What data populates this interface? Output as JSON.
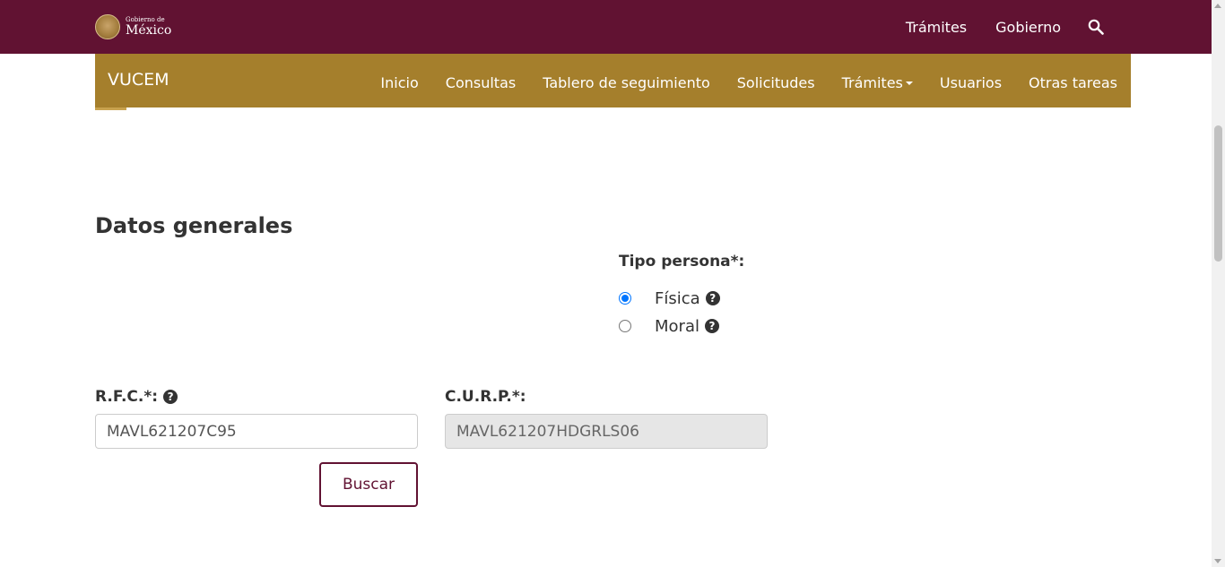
{
  "header": {
    "logo_small": "Gobierno de",
    "logo_big": "México",
    "links": [
      "Trámites",
      "Gobierno"
    ],
    "search_icon": "search-icon",
    "bg_color": "#611232"
  },
  "subnav": {
    "brand": "VUCEM",
    "items": [
      "Inicio",
      "Consultas",
      "Tablero de seguimiento",
      "Solicitudes",
      "Trámites",
      "Usuarios",
      "Otras tareas"
    ],
    "bg_color": "#a57f2c"
  },
  "form": {
    "title": "Datos generales",
    "tipo_persona_label": "Tipo persona*:",
    "options": [
      {
        "label": "Física",
        "selected": true
      },
      {
        "label": "Moral",
        "selected": false
      }
    ],
    "rfc_label": "R.F.C.*:",
    "rfc_value": "MAVL621207C95",
    "curp_label": "C.U.R.P.*:",
    "curp_value": "MAVL621207HDGRLS06",
    "search_button": "Buscar"
  }
}
